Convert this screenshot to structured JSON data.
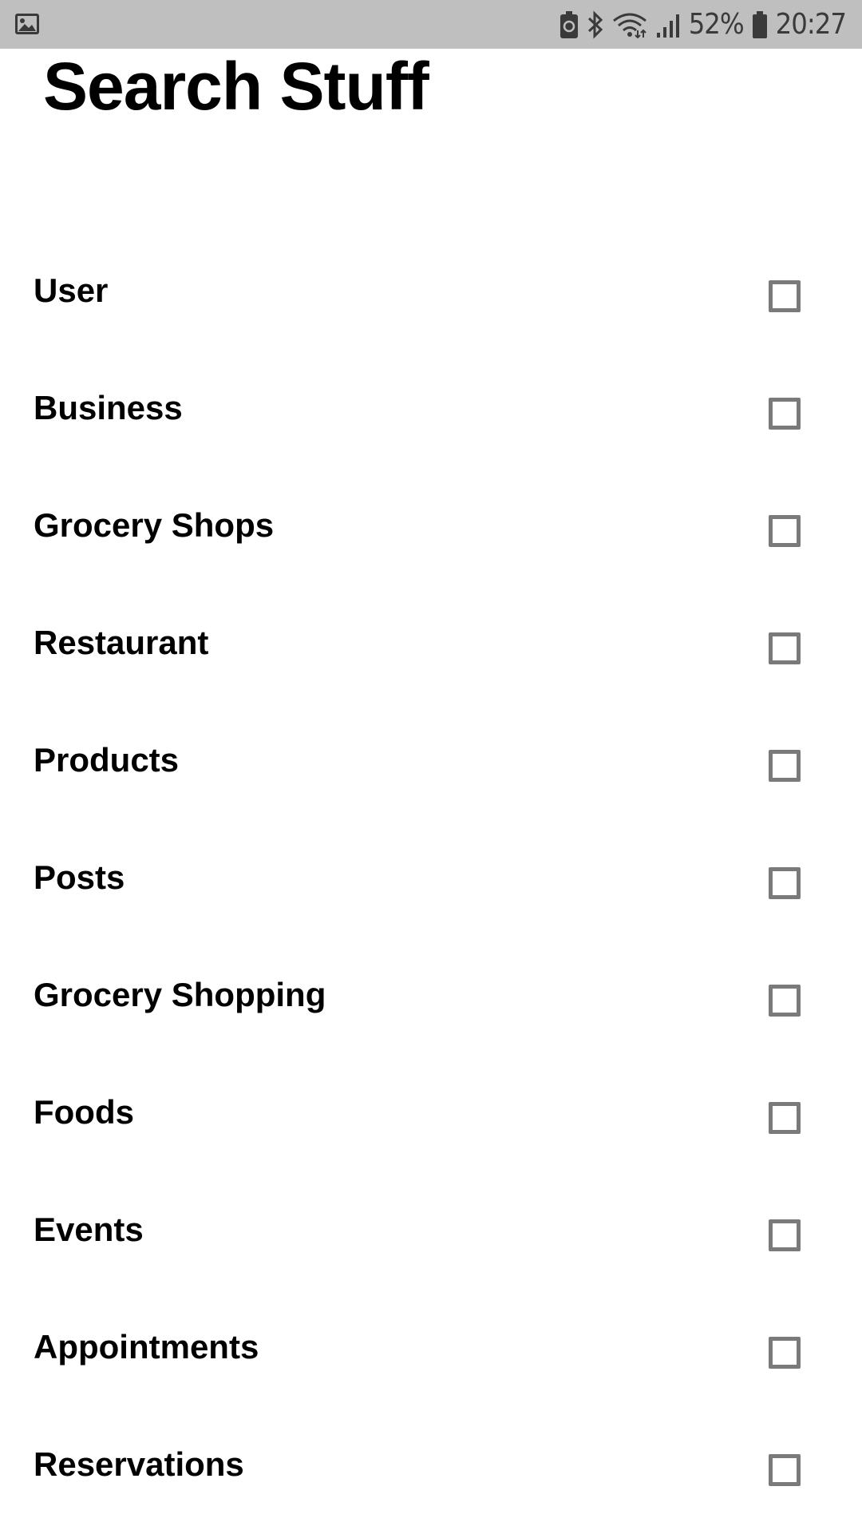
{
  "status_bar": {
    "left_icon": "image-icon",
    "icons": [
      "battery-saver-icon",
      "bluetooth-icon",
      "wifi-icon",
      "signal-icon",
      "battery-icon"
    ],
    "battery_percent": "52%",
    "time": "20:27"
  },
  "page": {
    "title": "Search Stuff"
  },
  "options": [
    {
      "label": "User",
      "checked": false
    },
    {
      "label": "Business",
      "checked": false
    },
    {
      "label": "Grocery Shops",
      "checked": false
    },
    {
      "label": "Restaurant",
      "checked": false
    },
    {
      "label": "Products",
      "checked": false
    },
    {
      "label": "Posts",
      "checked": false
    },
    {
      "label": "Grocery Shopping",
      "checked": false
    },
    {
      "label": "Foods",
      "checked": false
    },
    {
      "label": "Events",
      "checked": false
    },
    {
      "label": "Appointments",
      "checked": false
    },
    {
      "label": "Reservations",
      "checked": false
    }
  ],
  "colors": {
    "status_bar_bg": "#bfbfbf",
    "checkbox_border": "#7a7a7a",
    "text": "#000000"
  }
}
